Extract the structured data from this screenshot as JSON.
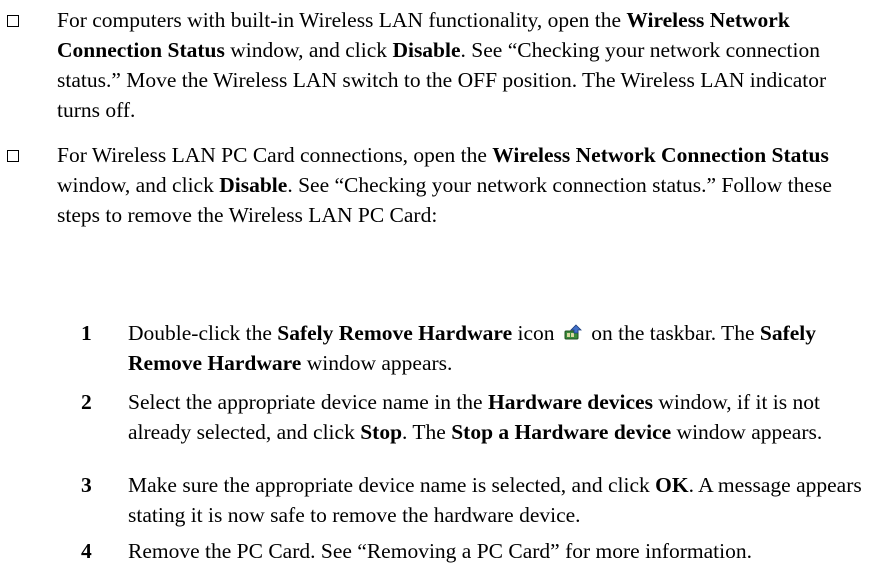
{
  "bullets": [
    {
      "segments": [
        {
          "text": "For computers with built-in Wireless LAN functionality, open the ",
          "bold": false
        },
        {
          "text": "Wireless Network Connection Status",
          "bold": true
        },
        {
          "text": " window, and click ",
          "bold": false
        },
        {
          "text": "Disable",
          "bold": true
        },
        {
          "text": ". See “Checking your network connection status.” Move the Wireless LAN switch to the OFF position. The Wireless LAN indicator turns off.",
          "bold": false
        }
      ]
    },
    {
      "segments": [
        {
          "text": "For Wireless LAN PC Card connections, open the ",
          "bold": false
        },
        {
          "text": "Wireless Network Connection Status",
          "bold": true
        },
        {
          "text": " window, and click ",
          "bold": false
        },
        {
          "text": "Disable",
          "bold": true
        },
        {
          "text": ". See “Checking your network connection status.” Follow these steps to remove the Wireless LAN PC Card:",
          "bold": false
        }
      ]
    }
  ],
  "steps": [
    {
      "number": "1",
      "segments": [
        {
          "text": "Double-click the ",
          "bold": false
        },
        {
          "text": "Safely Remove Hardware",
          "bold": true
        },
        {
          "text": " icon ",
          "bold": false
        },
        {
          "icon": "safely-remove-hardware-icon"
        },
        {
          "text": " on the taskbar. The ",
          "bold": false
        },
        {
          "text": "Safely Remove Hardware",
          "bold": true
        },
        {
          "text": " window appears.",
          "bold": false
        }
      ]
    },
    {
      "number": "2",
      "segments": [
        {
          "text": "Select the appropriate device name in the ",
          "bold": false
        },
        {
          "text": "Hardware devices",
          "bold": true
        },
        {
          "text": " window, if it is not already selected, and click ",
          "bold": false
        },
        {
          "text": "Stop",
          "bold": true
        },
        {
          "text": ". The ",
          "bold": false
        },
        {
          "text": "Stop a Hardware device",
          "bold": true
        },
        {
          "text": " window appears.",
          "bold": false
        }
      ]
    },
    {
      "number": "3",
      "segments": [
        {
          "text": "Make sure the appropriate device name is selected, and click ",
          "bold": false
        },
        {
          "text": "OK",
          "bold": true
        },
        {
          "text": ". A message appears stating it is now safe to remove the hardware device.",
          "bold": false
        }
      ]
    },
    {
      "number": "4",
      "segments": [
        {
          "text": "Remove the PC Card. See “Removing a PC Card” for more information.",
          "bold": false
        }
      ]
    }
  ]
}
